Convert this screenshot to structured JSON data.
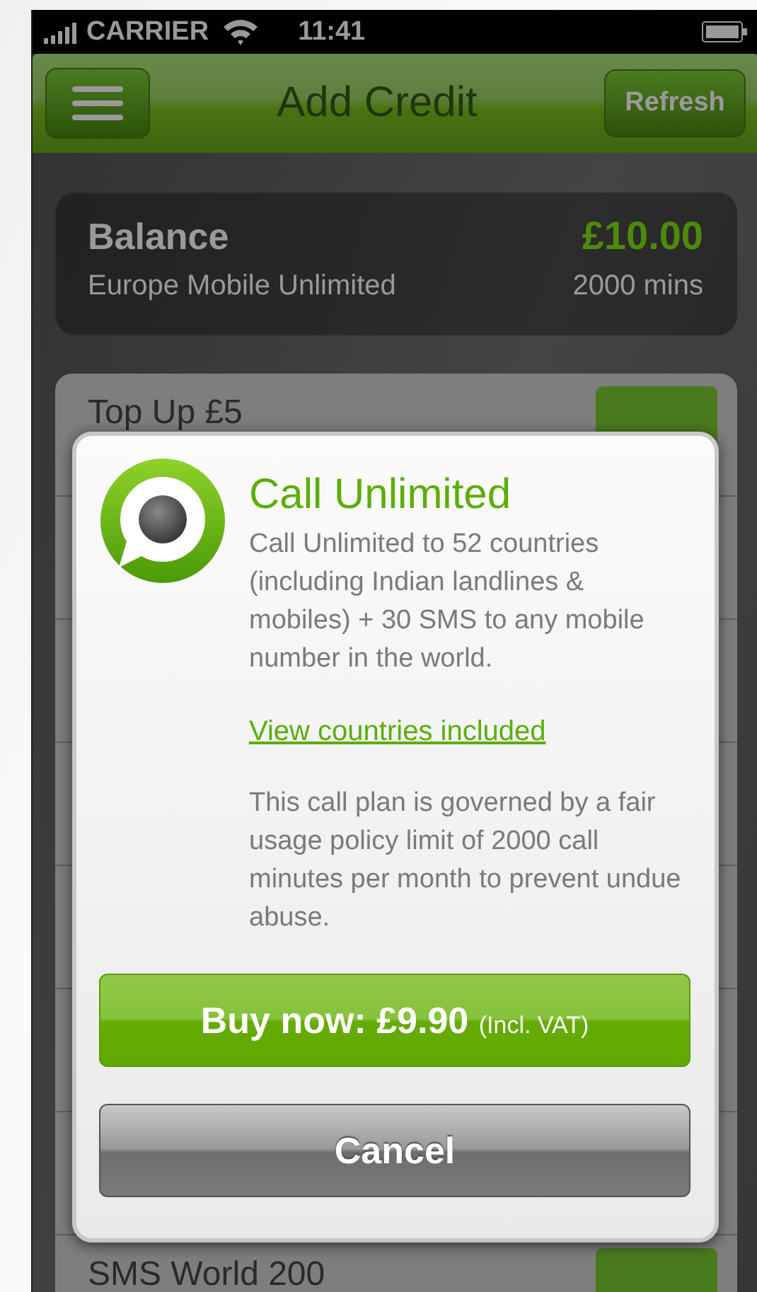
{
  "status_bar": {
    "carrier": "CARRIER",
    "time": "11:41"
  },
  "nav": {
    "title": "Add Credit",
    "refresh_button": "Refresh"
  },
  "balance": {
    "label": "Balance",
    "amount": "£10.00",
    "plan": "Europe Mobile Unlimited",
    "minutes": "2000 mins"
  },
  "list": {
    "items": [
      {
        "name": "Top Up £5"
      },
      {
        "name": "SMS World 200"
      }
    ]
  },
  "dialog": {
    "title": "Call Unlimited",
    "description": "Call Unlimited to 52 countries (including Indian landlines & mobiles) + 30 SMS to any mobile number in the world.",
    "link": "View countries included",
    "policy": "This call plan is governed by a fair usage policy limit of 2000 call minutes per month to prevent undue abuse.",
    "buy_button": {
      "label": "Buy now: £9.90",
      "note": "(Incl. VAT)"
    },
    "cancel_button": "Cancel"
  }
}
